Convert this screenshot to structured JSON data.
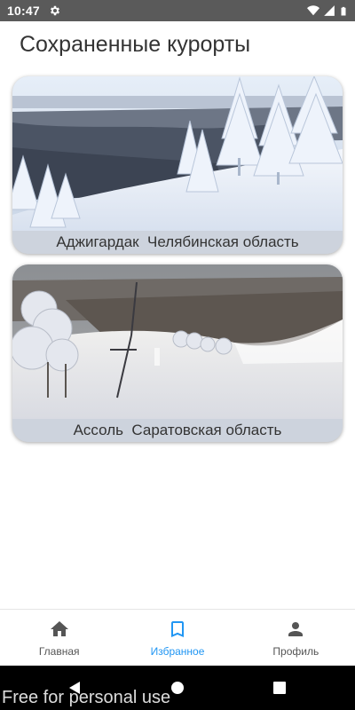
{
  "status_bar": {
    "time": "10:47",
    "icons": [
      "gear-icon",
      "wifi-icon",
      "signal-icon",
      "battery-icon"
    ]
  },
  "page": {
    "title": "Сохраненные курорты"
  },
  "resorts": [
    {
      "caption": "Аджигардак  Челябинская область",
      "image": "snowy-forest-slope-photo"
    },
    {
      "caption": "Ассоль  Саратовская область",
      "image": "ski-lift-slope-photo"
    }
  ],
  "bottom_nav": {
    "items": [
      {
        "label": "Главная",
        "icon": "home-icon",
        "active": false
      },
      {
        "label": "Избранное",
        "icon": "bookmark-icon",
        "active": true
      },
      {
        "label": "Профиль",
        "icon": "person-icon",
        "active": false
      }
    ],
    "active_color": "#2196f3"
  },
  "system_nav": {
    "icons": [
      "back-icon",
      "home-circle-icon",
      "recents-icon"
    ]
  },
  "watermark": "Free for personal use"
}
